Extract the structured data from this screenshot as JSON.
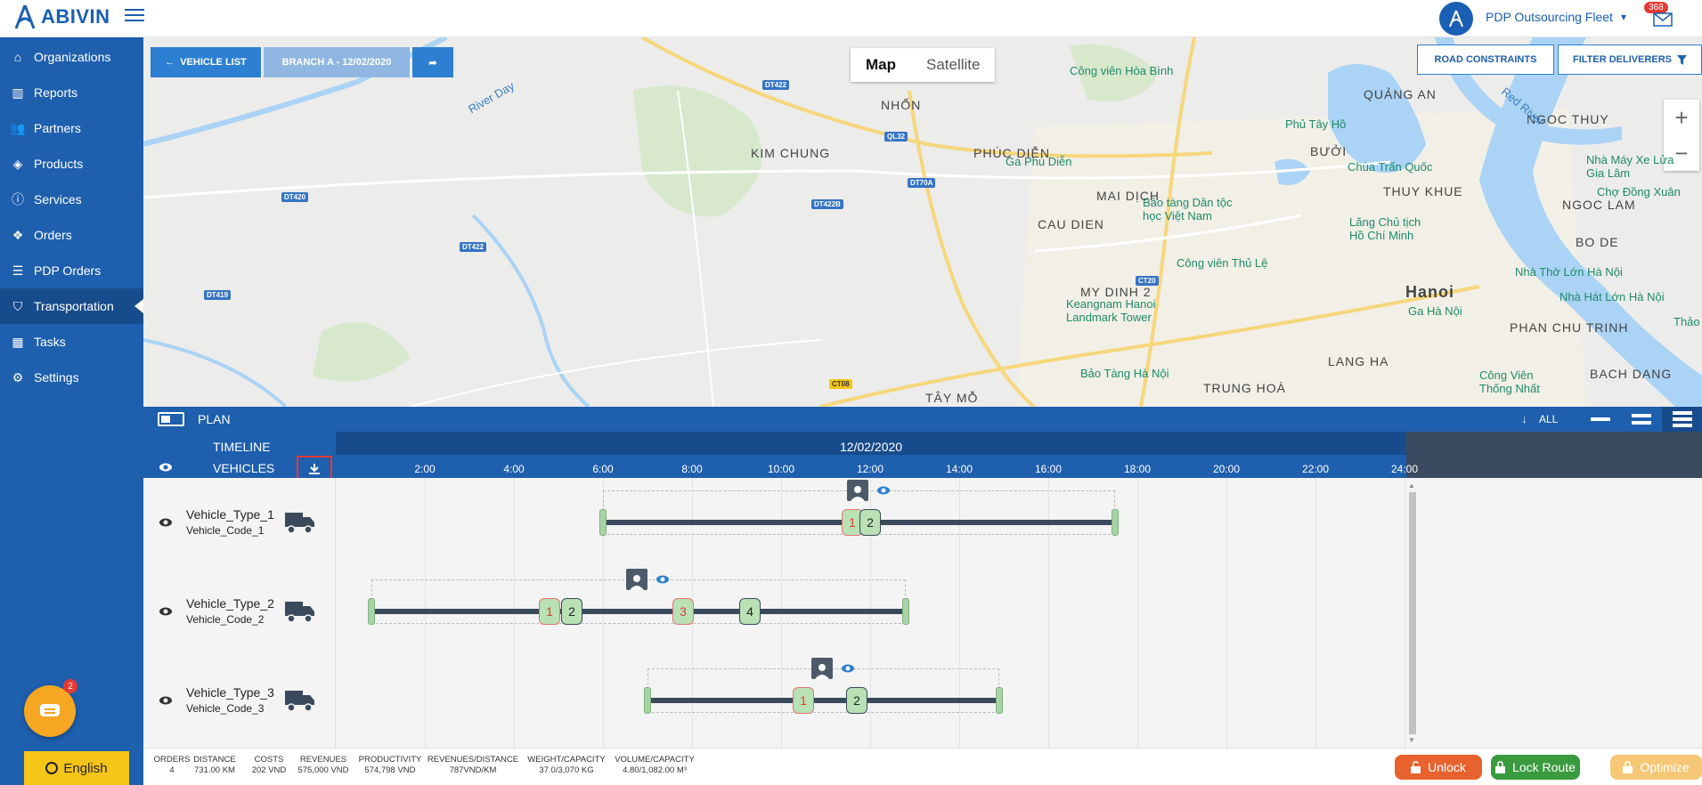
{
  "app": {
    "logo_text": "ABIVIN",
    "fleet_name": "PDP Outsourcing Fleet",
    "mail_count": "368"
  },
  "sidebar": {
    "items": [
      {
        "label": "Organizations",
        "icon": "home-icon"
      },
      {
        "label": "Reports",
        "icon": "bar-chart-icon"
      },
      {
        "label": "Partners",
        "icon": "users-icon"
      },
      {
        "label": "Products",
        "icon": "boxes-icon"
      },
      {
        "label": "Services",
        "icon": "info-icon"
      },
      {
        "label": "Orders",
        "icon": "cubes-icon"
      },
      {
        "label": "PDP Orders",
        "icon": "list-icon"
      },
      {
        "label": "Transportation",
        "icon": "road-icon",
        "active": true
      },
      {
        "label": "Tasks",
        "icon": "calendar-icon"
      },
      {
        "label": "Settings",
        "icon": "gear-icon"
      }
    ],
    "chat_badge": "2",
    "language": "English"
  },
  "map": {
    "vehicle_list_label": "VEHICLE LIST",
    "branch_label": "BRANCH A - 12/02/2020",
    "map_type_options": [
      "Map",
      "Satellite"
    ],
    "map_type_selected": "Map",
    "road_constraints_label": "ROAD CONSTRAINTS",
    "filter_deliverers_label": "FILTER DELIVERERS",
    "zoom_in": "+",
    "zoom_out": "−",
    "labels": {
      "nhon": "NHỔN",
      "kim_chung": "KIM CHUNG",
      "phuc_dien": "PHÚC DIỄN",
      "mai_dich": "MAI DỊCH",
      "cau_dien": "CAU DIEN",
      "my_dinh": "MY DINH 2",
      "tay_mo": "TÂY MỖ",
      "trung_hoa": "TRUNG HOÀ",
      "hanoi": "Hanoi",
      "quang_an": "QUẢNG AN",
      "buoi": "BƯỞI",
      "thuy_khue": "THUY KHUE",
      "ngoc_thuy": "NGOC THUY",
      "ngoc_lam": "NGOC LAM",
      "bo_de": "BO DE",
      "lang_ha": "LANG HA",
      "phan_chu_trinh": "PHAN CHU TRINH",
      "bach_dang": "BACH DANG",
      "cv_hoa_binh": "Công viên Hòa Bình",
      "phu_tay_ho": "Phủ Tây Hồ",
      "chua_tran_quoc": "Chùa Trấn Quốc",
      "ga_phu_dien": "Ga Phú Diễn",
      "bt_dan_toc": "Bảo tàng Dân tộc học Việt Nam",
      "lang_chu_tich": "Lăng Chủ tịch Hồ Chí Minh",
      "cho_dong_xuan": "Chợ Đồng Xuân",
      "cv_thu_le": "Công viên Thủ Lệ",
      "nha_tho_lon": "Nhà Thờ Lớn Hà Nội",
      "nha_hat_lon": "Nhà Hát Lớn Hà Nội",
      "ga_ha_noi": "Ga Hà Nội",
      "thao_n": "Thảo N",
      "keangnam": "Keangnam Hanoi Landmark Tower",
      "bt_ha_noi": "Bảo Tàng Hà Nội",
      "cv_thong_nhat": "Công Viên Thống Nhất",
      "nha_may": "Nhà Máy Xe Lửa Gia Lâm",
      "river_day": "River Day",
      "river_red": "Red River"
    },
    "shields": [
      "DT422",
      "QL32",
      "DT420",
      "DT422B",
      "DT70A",
      "DT419",
      "CT20",
      "CT08",
      "DT422"
    ]
  },
  "plan": {
    "title": "PLAN",
    "all_label": "ALL"
  },
  "timeline": {
    "timeline_label": "TIMELINE",
    "vehicles_label": "VEHICLES",
    "date": "12/02/2020",
    "hours": [
      "2:00",
      "4:00",
      "6:00",
      "8:00",
      "10:00",
      "12:00",
      "14:00",
      "16:00",
      "18:00",
      "20:00",
      "22:00",
      "24:00"
    ]
  },
  "vehicles": [
    {
      "type": "Vehicle_Type_1",
      "code": "Vehicle_Code_1",
      "start_hour": 6.0,
      "end_hour": 17.5,
      "stops": [
        {
          "label": "1",
          "status": "red",
          "hour": 11.6
        },
        {
          "label": "2",
          "status": "green",
          "hour": 12.0
        }
      ]
    },
    {
      "type": "Vehicle_Type_2",
      "code": "Vehicle_Code_2",
      "start_hour": 0.8,
      "end_hour": 12.8,
      "stops": [
        {
          "label": "1",
          "status": "red",
          "hour": 4.8
        },
        {
          "label": "2",
          "status": "green",
          "hour": 5.3
        },
        {
          "label": "3",
          "status": "red",
          "hour": 7.8
        },
        {
          "label": "4",
          "status": "green",
          "hour": 9.3
        }
      ]
    },
    {
      "type": "Vehicle_Type_3",
      "code": "Vehicle_Code_3",
      "start_hour": 7.0,
      "end_hour": 14.9,
      "stops": [
        {
          "label": "1",
          "status": "red",
          "hour": 10.5
        },
        {
          "label": "2",
          "status": "green",
          "hour": 11.7
        }
      ]
    }
  ],
  "stats": [
    {
      "label": "ORDERS",
      "value": "4"
    },
    {
      "label": "DISTANCE",
      "value": "731.00 KM"
    },
    {
      "label": "COSTS",
      "value": "202 VND"
    },
    {
      "label": "REVENUES",
      "value": "575,000 VND"
    },
    {
      "label": "PRODUCTIVITY",
      "value": "574,798 VND"
    },
    {
      "label": "REVENUES/DISTANCE",
      "value": "787VND/KM"
    },
    {
      "label": "WEIGHT/CAPACITY",
      "value": "37.0/3,070 KG"
    },
    {
      "label": "VOLUME/CAPACITY",
      "value": "4.80/1,082.00 M³"
    }
  ],
  "actions": {
    "unlock": "Unlock",
    "lock_route": "Lock Route",
    "optimize": "Optimize"
  },
  "colors": {
    "primary": "#1e5fae",
    "unlock": "#e8622e",
    "lock": "#3a9a3e",
    "optimize": "#f6c775"
  }
}
